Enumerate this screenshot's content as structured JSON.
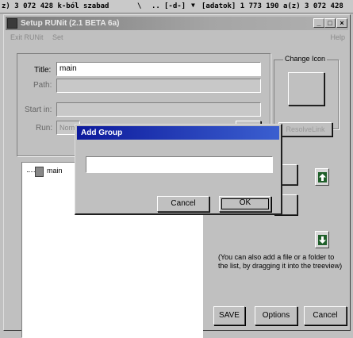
{
  "statusbar": {
    "left_text": "z) 3 072 428 k-ból szabad",
    "sep1": "\\",
    "sep2": "..",
    "drive": "[-d-]",
    "right_text": "[adatok]  1 773 190 a(z) 3 072 428"
  },
  "window": {
    "title": "Setup RUNit (2.1 BETA 6a)",
    "buttons": {
      "minimize": "_",
      "maximize": "□",
      "close": "×"
    },
    "menu": [
      "Exit RUNit",
      "Set"
    ],
    "help": "Help"
  },
  "form": {
    "title_label": "Title:",
    "title_value": "main",
    "path_label": "Path:",
    "path_value": "",
    "start_label": "Start in:",
    "start_value": "",
    "run_label": "Run:",
    "run_value": "Norm",
    "change_icon_label": "Change Icon",
    "resolve_label": "ResolveLink"
  },
  "tree": {
    "items": [
      {
        "label": "main"
      }
    ]
  },
  "hint": "(You can also add a file or a folder to the list, by dragging it into the treeview)",
  "buttons": {
    "save": "SAVE",
    "options": "Options",
    "cancel": "Cancel"
  },
  "dialog": {
    "title": "Add Group",
    "input_value": "",
    "cancel": "Cancel",
    "ok": "OK"
  },
  "colors": {
    "dialog_title": "#0d1a9c",
    "arrow_button": "#1f5f2a",
    "window_face": "#c0c0c0"
  }
}
